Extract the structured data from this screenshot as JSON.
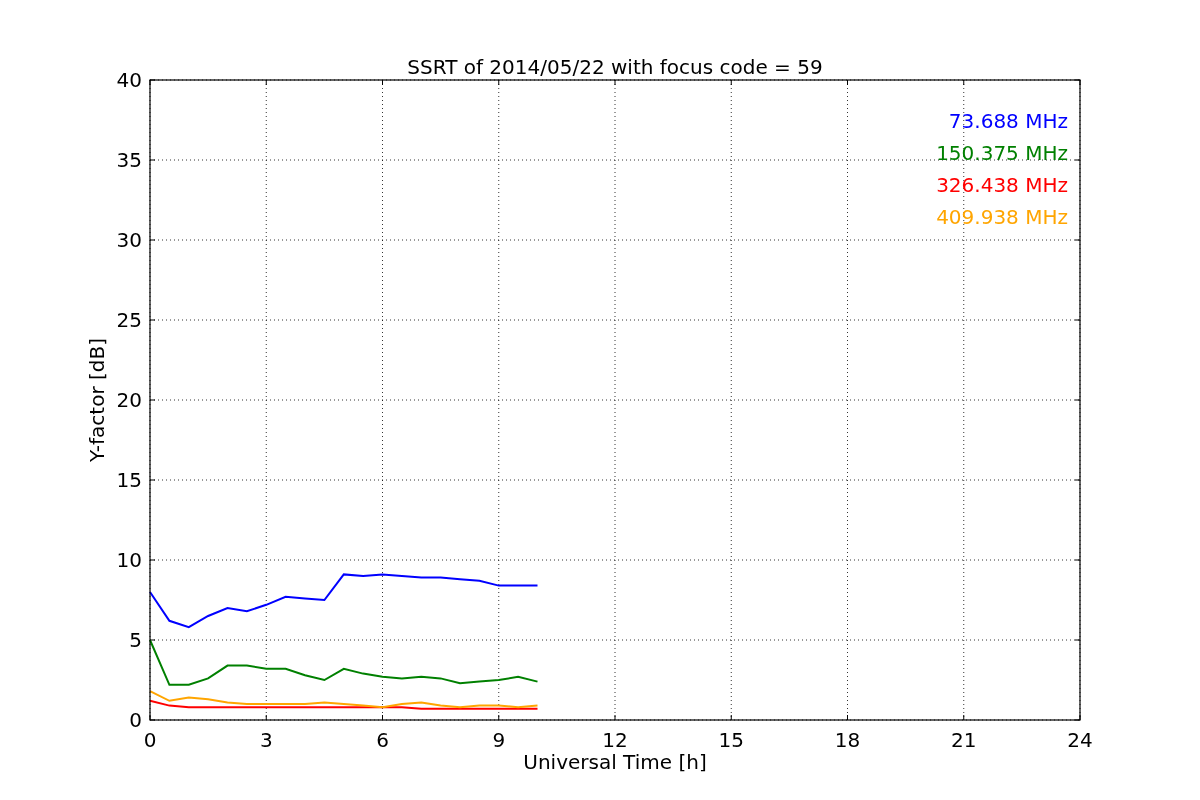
{
  "chart_data": {
    "type": "line",
    "title": "SSRT of 2014/05/22 with focus code = 59",
    "xlabel": "Universal Time [h]",
    "ylabel": "Y-factor [dB]",
    "x": [
      0,
      0.5,
      1,
      1.5,
      2,
      2.5,
      3,
      3.5,
      4,
      4.5,
      5,
      5.5,
      6,
      6.5,
      7,
      7.5,
      8,
      8.5,
      9,
      9.5,
      10
    ],
    "grid": true,
    "xlim": [
      0,
      24
    ],
    "ylim": [
      0,
      40
    ],
    "xticks": [
      0,
      3,
      6,
      9,
      12,
      15,
      18,
      21,
      24
    ],
    "yticks": [
      0,
      5,
      10,
      15,
      20,
      25,
      30,
      35,
      40
    ],
    "series": [
      {
        "name": "73.688 MHz",
        "color": "#0000ff",
        "values": [
          8,
          6.2,
          5.8,
          6.5,
          7,
          6.8,
          7.2,
          7.7,
          7.6,
          7.5,
          9.1,
          9,
          9.1,
          9,
          8.9,
          8.9,
          8.8,
          8.7,
          8.4,
          8.4,
          8.4
        ]
      },
      {
        "name": "150.375 MHz",
        "color": "#008000",
        "values": [
          5,
          2.2,
          2.2,
          2.6,
          3.4,
          3.4,
          3.2,
          3.2,
          2.8,
          2.5,
          3.2,
          2.9,
          2.7,
          2.6,
          2.7,
          2.6,
          2.3,
          2.4,
          2.5,
          2.7,
          2.4
        ]
      },
      {
        "name": "326.438 MHz",
        "color": "#ff0000",
        "values": [
          1.2,
          0.9,
          0.8,
          0.8,
          0.8,
          0.8,
          0.8,
          0.8,
          0.8,
          0.8,
          0.8,
          0.8,
          0.8,
          0.8,
          0.7,
          0.7,
          0.7,
          0.7,
          0.7,
          0.7,
          0.7
        ]
      },
      {
        "name": "409.938 MHz",
        "color": "#ffa500",
        "values": [
          1.8,
          1.2,
          1.4,
          1.3,
          1.1,
          1,
          1,
          1,
          1,
          1.1,
          1,
          0.9,
          0.8,
          1,
          1.1,
          0.9,
          0.8,
          0.9,
          0.9,
          0.8,
          0.9
        ]
      }
    ]
  }
}
